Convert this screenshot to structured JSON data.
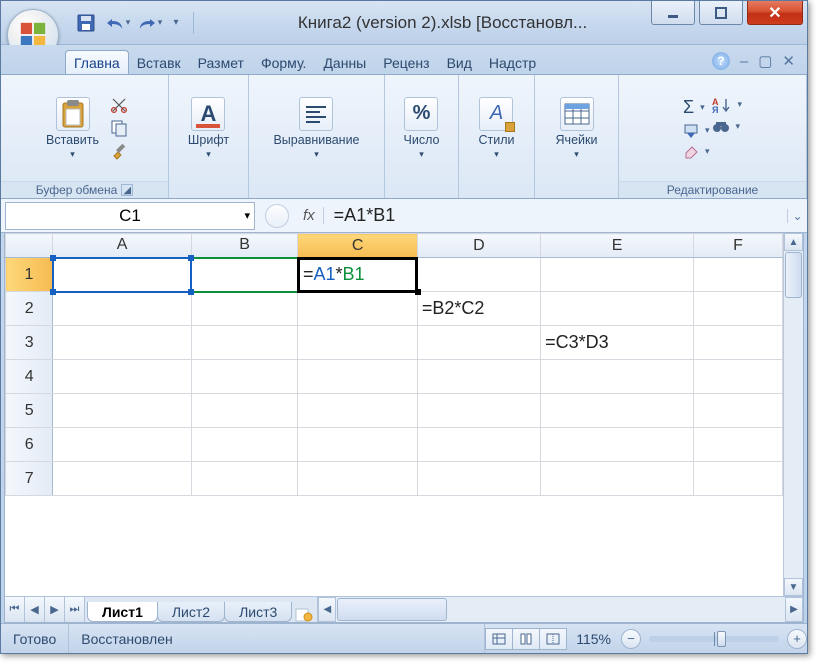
{
  "window": {
    "title": "Книга2 (version 2).xlsb [Восстановл..."
  },
  "tabs": {
    "items": [
      "Главна",
      "Вставк",
      "Размет",
      "Форму.",
      "Данны",
      "Реценз",
      "Вид",
      "Надстр"
    ],
    "active_index": 0
  },
  "ribbon": {
    "clipboard": {
      "paste": "Вставить",
      "label": "Буфер обмена"
    },
    "font": {
      "label": "Шрифт"
    },
    "align": {
      "label": "Выравнивание"
    },
    "number": {
      "label": "Число",
      "icon_text": "%"
    },
    "styles": {
      "label": "Стили"
    },
    "cells": {
      "label": "Ячейки"
    },
    "editing": {
      "label": "Редактирование",
      "sigma": "Σ"
    }
  },
  "formula_bar": {
    "name_box": "C1",
    "fx": "fx",
    "formula": "=A1*B1"
  },
  "grid": {
    "columns": [
      "A",
      "B",
      "C",
      "D",
      "E",
      "F"
    ],
    "rows": [
      "1",
      "2",
      "3",
      "4",
      "5",
      "6",
      "7"
    ],
    "active_cell": "C1",
    "active_col": "C",
    "active_row": "1",
    "cells": {
      "C1": {
        "display_tokens": [
          "=",
          "A1",
          "*",
          "B1"
        ]
      },
      "D2": {
        "display": "=B2*C2"
      },
      "E3": {
        "display": "=C3*D3"
      }
    }
  },
  "sheet_tabs": {
    "items": [
      "Лист1",
      "Лист2",
      "Лист3"
    ],
    "active_index": 0
  },
  "status": {
    "ready": "Готово",
    "recovered": "Восстановлен",
    "zoom": "115%"
  }
}
